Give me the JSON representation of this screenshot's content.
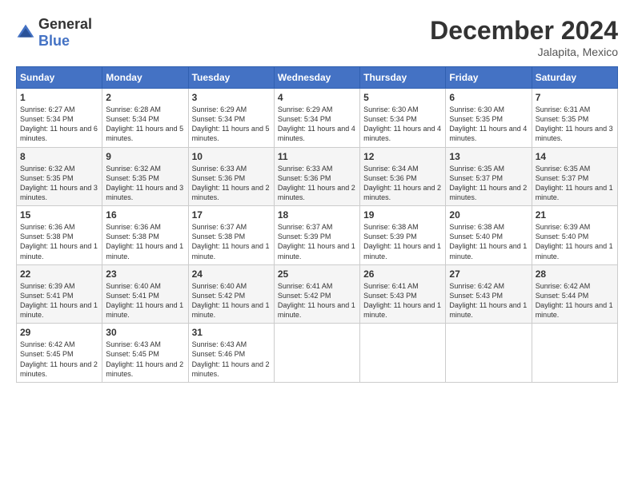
{
  "logo": {
    "general": "General",
    "blue": "Blue"
  },
  "title": "December 2024",
  "location": "Jalapita, Mexico",
  "days_header": [
    "Sunday",
    "Monday",
    "Tuesday",
    "Wednesday",
    "Thursday",
    "Friday",
    "Saturday"
  ],
  "weeks": [
    [
      {
        "day": "1",
        "sunrise": "6:27 AM",
        "sunset": "5:34 PM",
        "daylight": "11 hours and 6 minutes."
      },
      {
        "day": "2",
        "sunrise": "6:28 AM",
        "sunset": "5:34 PM",
        "daylight": "11 hours and 5 minutes."
      },
      {
        "day": "3",
        "sunrise": "6:29 AM",
        "sunset": "5:34 PM",
        "daylight": "11 hours and 5 minutes."
      },
      {
        "day": "4",
        "sunrise": "6:29 AM",
        "sunset": "5:34 PM",
        "daylight": "11 hours and 4 minutes."
      },
      {
        "day": "5",
        "sunrise": "6:30 AM",
        "sunset": "5:34 PM",
        "daylight": "11 hours and 4 minutes."
      },
      {
        "day": "6",
        "sunrise": "6:30 AM",
        "sunset": "5:35 PM",
        "daylight": "11 hours and 4 minutes."
      },
      {
        "day": "7",
        "sunrise": "6:31 AM",
        "sunset": "5:35 PM",
        "daylight": "11 hours and 3 minutes."
      }
    ],
    [
      {
        "day": "8",
        "sunrise": "6:32 AM",
        "sunset": "5:35 PM",
        "daylight": "11 hours and 3 minutes."
      },
      {
        "day": "9",
        "sunrise": "6:32 AM",
        "sunset": "5:35 PM",
        "daylight": "11 hours and 3 minutes."
      },
      {
        "day": "10",
        "sunrise": "6:33 AM",
        "sunset": "5:36 PM",
        "daylight": "11 hours and 2 minutes."
      },
      {
        "day": "11",
        "sunrise": "6:33 AM",
        "sunset": "5:36 PM",
        "daylight": "11 hours and 2 minutes."
      },
      {
        "day": "12",
        "sunrise": "6:34 AM",
        "sunset": "5:36 PM",
        "daylight": "11 hours and 2 minutes."
      },
      {
        "day": "13",
        "sunrise": "6:35 AM",
        "sunset": "5:37 PM",
        "daylight": "11 hours and 2 minutes."
      },
      {
        "day": "14",
        "sunrise": "6:35 AM",
        "sunset": "5:37 PM",
        "daylight": "11 hours and 1 minute."
      }
    ],
    [
      {
        "day": "15",
        "sunrise": "6:36 AM",
        "sunset": "5:38 PM",
        "daylight": "11 hours and 1 minute."
      },
      {
        "day": "16",
        "sunrise": "6:36 AM",
        "sunset": "5:38 PM",
        "daylight": "11 hours and 1 minute."
      },
      {
        "day": "17",
        "sunrise": "6:37 AM",
        "sunset": "5:38 PM",
        "daylight": "11 hours and 1 minute."
      },
      {
        "day": "18",
        "sunrise": "6:37 AM",
        "sunset": "5:39 PM",
        "daylight": "11 hours and 1 minute."
      },
      {
        "day": "19",
        "sunrise": "6:38 AM",
        "sunset": "5:39 PM",
        "daylight": "11 hours and 1 minute."
      },
      {
        "day": "20",
        "sunrise": "6:38 AM",
        "sunset": "5:40 PM",
        "daylight": "11 hours and 1 minute."
      },
      {
        "day": "21",
        "sunrise": "6:39 AM",
        "sunset": "5:40 PM",
        "daylight": "11 hours and 1 minute."
      }
    ],
    [
      {
        "day": "22",
        "sunrise": "6:39 AM",
        "sunset": "5:41 PM",
        "daylight": "11 hours and 1 minute."
      },
      {
        "day": "23",
        "sunrise": "6:40 AM",
        "sunset": "5:41 PM",
        "daylight": "11 hours and 1 minute."
      },
      {
        "day": "24",
        "sunrise": "6:40 AM",
        "sunset": "5:42 PM",
        "daylight": "11 hours and 1 minute."
      },
      {
        "day": "25",
        "sunrise": "6:41 AM",
        "sunset": "5:42 PM",
        "daylight": "11 hours and 1 minute."
      },
      {
        "day": "26",
        "sunrise": "6:41 AM",
        "sunset": "5:43 PM",
        "daylight": "11 hours and 1 minute."
      },
      {
        "day": "27",
        "sunrise": "6:42 AM",
        "sunset": "5:43 PM",
        "daylight": "11 hours and 1 minute."
      },
      {
        "day": "28",
        "sunrise": "6:42 AM",
        "sunset": "5:44 PM",
        "daylight": "11 hours and 1 minute."
      }
    ],
    [
      {
        "day": "29",
        "sunrise": "6:42 AM",
        "sunset": "5:45 PM",
        "daylight": "11 hours and 2 minutes."
      },
      {
        "day": "30",
        "sunrise": "6:43 AM",
        "sunset": "5:45 PM",
        "daylight": "11 hours and 2 minutes."
      },
      {
        "day": "31",
        "sunrise": "6:43 AM",
        "sunset": "5:46 PM",
        "daylight": "11 hours and 2 minutes."
      },
      null,
      null,
      null,
      null
    ]
  ],
  "labels": {
    "sunrise": "Sunrise:",
    "sunset": "Sunset:",
    "daylight": "Daylight:"
  }
}
